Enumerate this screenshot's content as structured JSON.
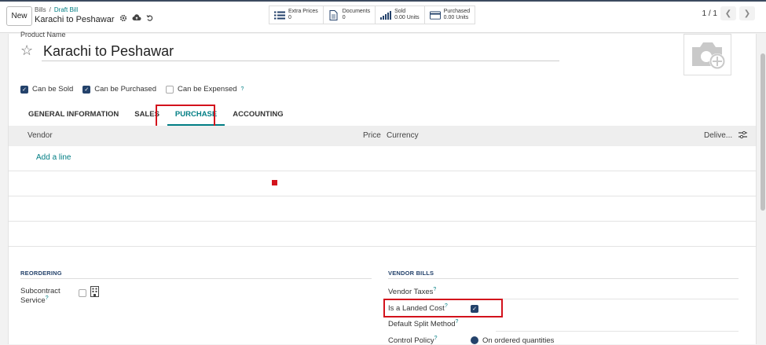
{
  "controlbar": {
    "new_label": "New",
    "breadcrumb": [
      "Bills",
      "Draft Bill"
    ],
    "record_title": "Karachi to Peshawar",
    "pager": "1 / 1",
    "smart_buttons": [
      {
        "title": "Extra Prices",
        "value": "0",
        "icon": "list-icon"
      },
      {
        "title": "Documents",
        "value": "0",
        "icon": "document-icon"
      },
      {
        "title": "Sold",
        "value": "0.00 Units",
        "icon": "bar-chart-icon"
      },
      {
        "title": "Purchased",
        "value": "0.00 Units",
        "icon": "credit-card-icon"
      }
    ]
  },
  "product": {
    "name_label": "Product Name",
    "name": "Karachi to Peshawar",
    "checkboxes": [
      {
        "label": "Can be Sold",
        "checked": true
      },
      {
        "label": "Can be Purchased",
        "checked": true
      },
      {
        "label": "Can be Expensed",
        "checked": false,
        "help": "?"
      }
    ]
  },
  "tabs": [
    "GENERAL INFORMATION",
    "SALES",
    "PURCHASE",
    "ACCOUNTING"
  ],
  "active_tab": "PURCHASE",
  "vendor_table": {
    "columns": [
      "Vendor",
      "Price",
      "Currency",
      "Delive..."
    ],
    "add_line": "Add a line"
  },
  "reordering": {
    "title": "REORDERING",
    "subcontract_label_1": "Subcontract",
    "subcontract_label_2": "Service",
    "help": "?"
  },
  "vendor_bills": {
    "title": "VENDOR BILLS",
    "vendor_taxes": "Vendor Taxes",
    "landed_cost": "Is a Landed Cost",
    "landed_cost_checked": true,
    "split_method": "Default Split Method",
    "control_policy": "Control Policy",
    "control_value": "On ordered quantities",
    "help": "?"
  },
  "colors": {
    "accent": "#017e84",
    "check": "#24426b",
    "highlight": "#d3121c"
  }
}
